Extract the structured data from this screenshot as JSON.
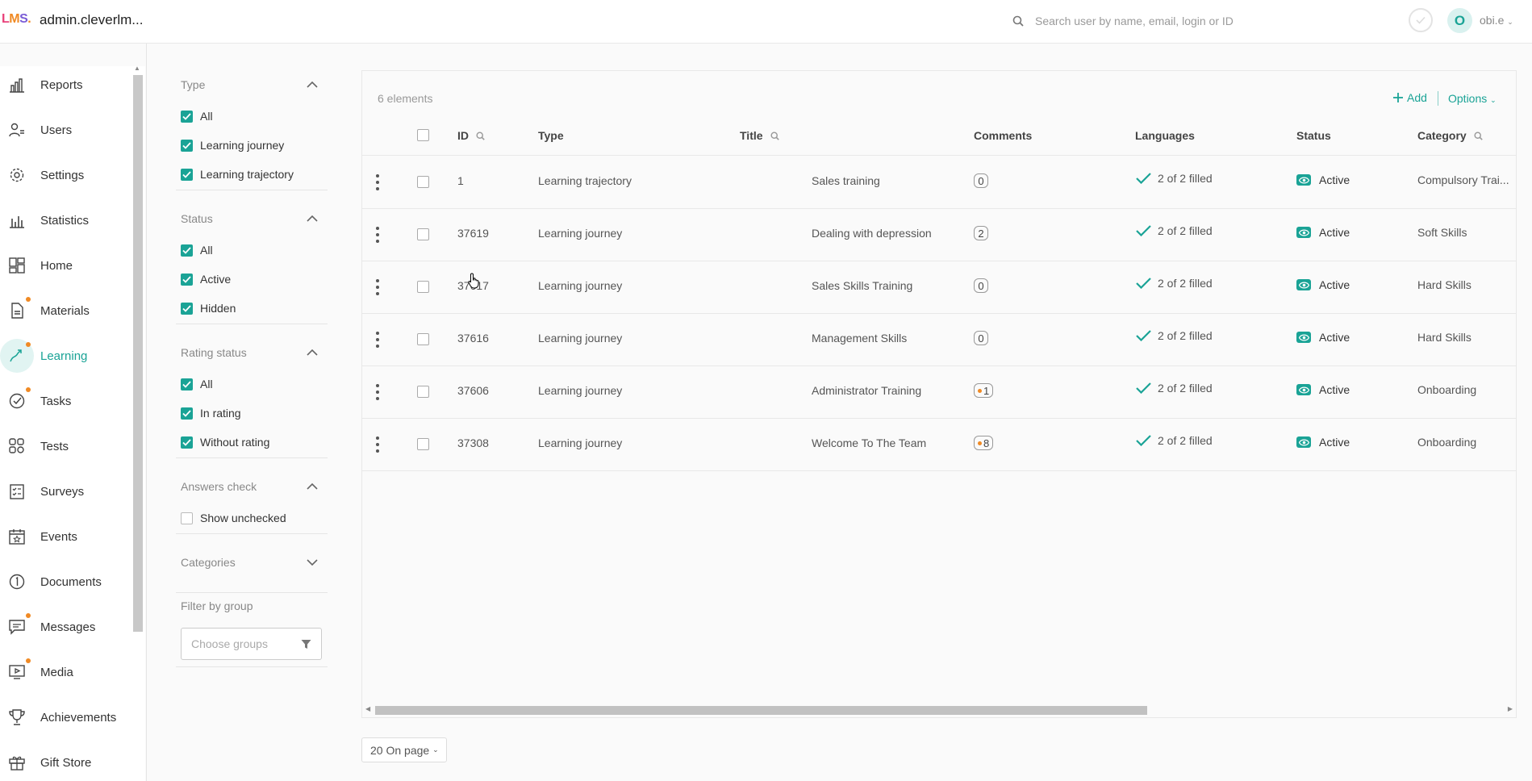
{
  "header": {
    "logo": "LMS.",
    "domain": "admin.cleverlm...",
    "search_placeholder": "Search user by name, email, login or ID",
    "avatar_letter": "O",
    "user_name": "obi.e"
  },
  "sidebar": {
    "items": [
      {
        "label": "Reports",
        "icon": "reports-icon",
        "dot": false
      },
      {
        "label": "Users",
        "icon": "users-icon",
        "dot": false
      },
      {
        "label": "Settings",
        "icon": "gear-icon",
        "dot": false
      },
      {
        "label": "Statistics",
        "icon": "statistics-icon",
        "dot": false
      },
      {
        "label": "Home",
        "icon": "home-icon",
        "dot": false
      },
      {
        "label": "Materials",
        "icon": "materials-icon",
        "dot": true
      },
      {
        "label": "Learning",
        "icon": "learning-icon",
        "dot": true,
        "active": true
      },
      {
        "label": "Tasks",
        "icon": "tasks-icon",
        "dot": true
      },
      {
        "label": "Tests",
        "icon": "tests-icon",
        "dot": false
      },
      {
        "label": "Surveys",
        "icon": "surveys-icon",
        "dot": false
      },
      {
        "label": "Events",
        "icon": "events-icon",
        "dot": false
      },
      {
        "label": "Documents",
        "icon": "documents-icon",
        "dot": false
      },
      {
        "label": "Messages",
        "icon": "messages-icon",
        "dot": true
      },
      {
        "label": "Media",
        "icon": "media-icon",
        "dot": true
      },
      {
        "label": "Achievements",
        "icon": "trophy-icon",
        "dot": false
      },
      {
        "label": "Gift Store",
        "icon": "gift-icon",
        "dot": false
      }
    ]
  },
  "filters": {
    "type": {
      "title": "Type",
      "options": [
        {
          "label": "All",
          "checked": true
        },
        {
          "label": "Learning journey",
          "checked": true
        },
        {
          "label": "Learning trajectory",
          "checked": true
        }
      ]
    },
    "status": {
      "title": "Status",
      "options": [
        {
          "label": "All",
          "checked": true
        },
        {
          "label": "Active",
          "checked": true
        },
        {
          "label": "Hidden",
          "checked": true
        }
      ]
    },
    "rating": {
      "title": "Rating status",
      "options": [
        {
          "label": "All",
          "checked": true
        },
        {
          "label": "In rating",
          "checked": true
        },
        {
          "label": "Without rating",
          "checked": true
        }
      ]
    },
    "answers": {
      "title": "Answers check",
      "options": [
        {
          "label": "Show unchecked",
          "checked": false
        }
      ]
    },
    "categories": {
      "title": "Categories"
    },
    "group": {
      "title": "Filter by group",
      "placeholder": "Choose groups"
    }
  },
  "table": {
    "count": "6 elements",
    "add_label": "Add",
    "options_label": "Options",
    "columns": {
      "id": "ID",
      "type": "Type",
      "title": "Title",
      "comments": "Comments",
      "languages": "Languages",
      "status": "Status",
      "category": "Category"
    },
    "rows": [
      {
        "id": "1",
        "type": "Learning trajectory",
        "title": "Sales training",
        "comments": "0",
        "comments_dot": false,
        "languages": "2 of 2 filled",
        "status": "Active",
        "category": "Compulsory Trai..."
      },
      {
        "id": "37619",
        "type": "Learning journey",
        "title": "Dealing with depression",
        "comments": "2",
        "comments_dot": false,
        "languages": "2 of 2 filled",
        "status": "Active",
        "category": "Soft Skills"
      },
      {
        "id": "37617",
        "type": "Learning journey",
        "title": "Sales Skills Training",
        "comments": "0",
        "comments_dot": false,
        "languages": "2 of 2 filled",
        "status": "Active",
        "category": "Hard Skills"
      },
      {
        "id": "37616",
        "type": "Learning journey",
        "title": "Management Skills",
        "comments": "0",
        "comments_dot": false,
        "languages": "2 of 2 filled",
        "status": "Active",
        "category": "Hard Skills"
      },
      {
        "id": "37606",
        "type": "Learning journey",
        "title": "Administrator Training",
        "comments": "1",
        "comments_dot": true,
        "languages": "2 of 2 filled",
        "status": "Active",
        "category": "Onboarding"
      },
      {
        "id": "37308",
        "type": "Learning journey",
        "title": "Welcome To The Team",
        "comments": "8",
        "comments_dot": true,
        "languages": "2 of 2 filled",
        "status": "Active",
        "category": "Onboarding"
      }
    ],
    "per_page": "20 On page"
  },
  "colors": {
    "accent": "#1aa396",
    "dot": "#f08a24"
  }
}
